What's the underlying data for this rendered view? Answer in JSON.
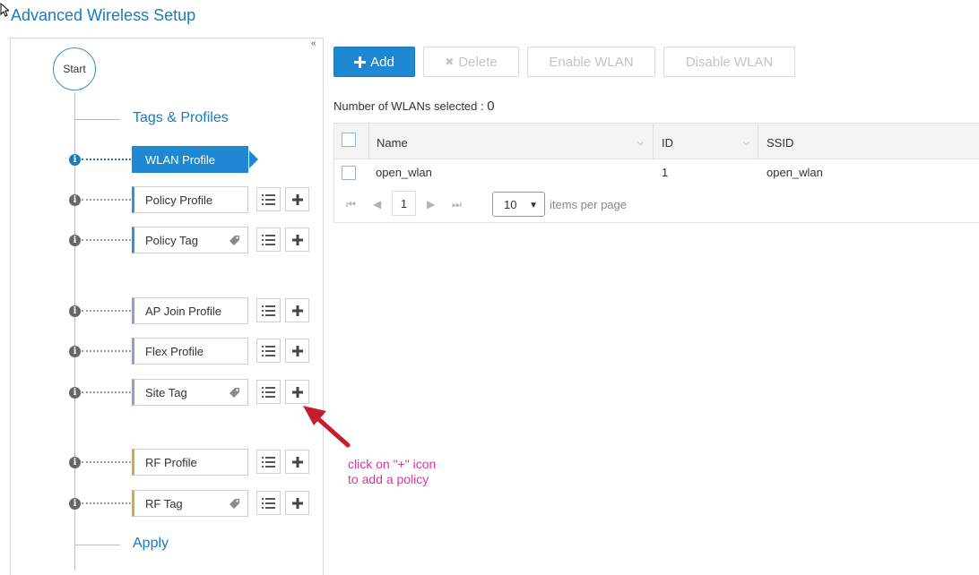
{
  "header": {
    "title": "Advanced Wireless Setup"
  },
  "wizard": {
    "start_label": "Start",
    "sections": {
      "tags_profiles": "Tags & Profiles",
      "apply": "Apply"
    },
    "steps": [
      {
        "label": "WLAN Profile",
        "active": true,
        "tag_icon": false
      },
      {
        "label": "Policy Profile",
        "active": false,
        "tag_icon": false
      },
      {
        "label": "Policy Tag",
        "active": false,
        "tag_icon": true
      },
      {
        "label": "AP Join Profile",
        "active": false,
        "tag_icon": false
      },
      {
        "label": "Flex Profile",
        "active": false,
        "tag_icon": false
      },
      {
        "label": "Site Tag",
        "active": false,
        "tag_icon": true
      },
      {
        "label": "RF Profile",
        "active": false,
        "tag_icon": false
      },
      {
        "label": "RF Tag",
        "active": false,
        "tag_icon": true
      }
    ],
    "accent_colors": [
      "#1f88d2",
      "#3f8fd0",
      "#3f8fd0",
      "#8e9fd6",
      "#8e9fd6",
      "#8e9fd6",
      "#d9a54a",
      "#d9a54a"
    ],
    "icons": {
      "info": "info-icon",
      "list": "list-icon",
      "add": "plus-icon",
      "tag": "tag-icon"
    }
  },
  "annotation": {
    "line1": "click on \"+\" icon",
    "line2": "to add a policy",
    "color": "#e0359b"
  },
  "toolbar": {
    "add": "Add",
    "delete": "Delete",
    "enable": "Enable WLAN",
    "disable": "Disable WLAN"
  },
  "selection": {
    "label": "Number of WLANs selected :",
    "count": "0"
  },
  "table": {
    "columns": [
      "Name",
      "ID",
      "SSID"
    ],
    "rows": [
      {
        "name": "open_wlan",
        "id": "1",
        "ssid": "open_wlan"
      }
    ]
  },
  "pager": {
    "current_page": "1",
    "page_size": "10",
    "per_page_label": "items per page"
  },
  "colors": {
    "primary": "#1f88d2",
    "title": "#1a7bbd"
  }
}
